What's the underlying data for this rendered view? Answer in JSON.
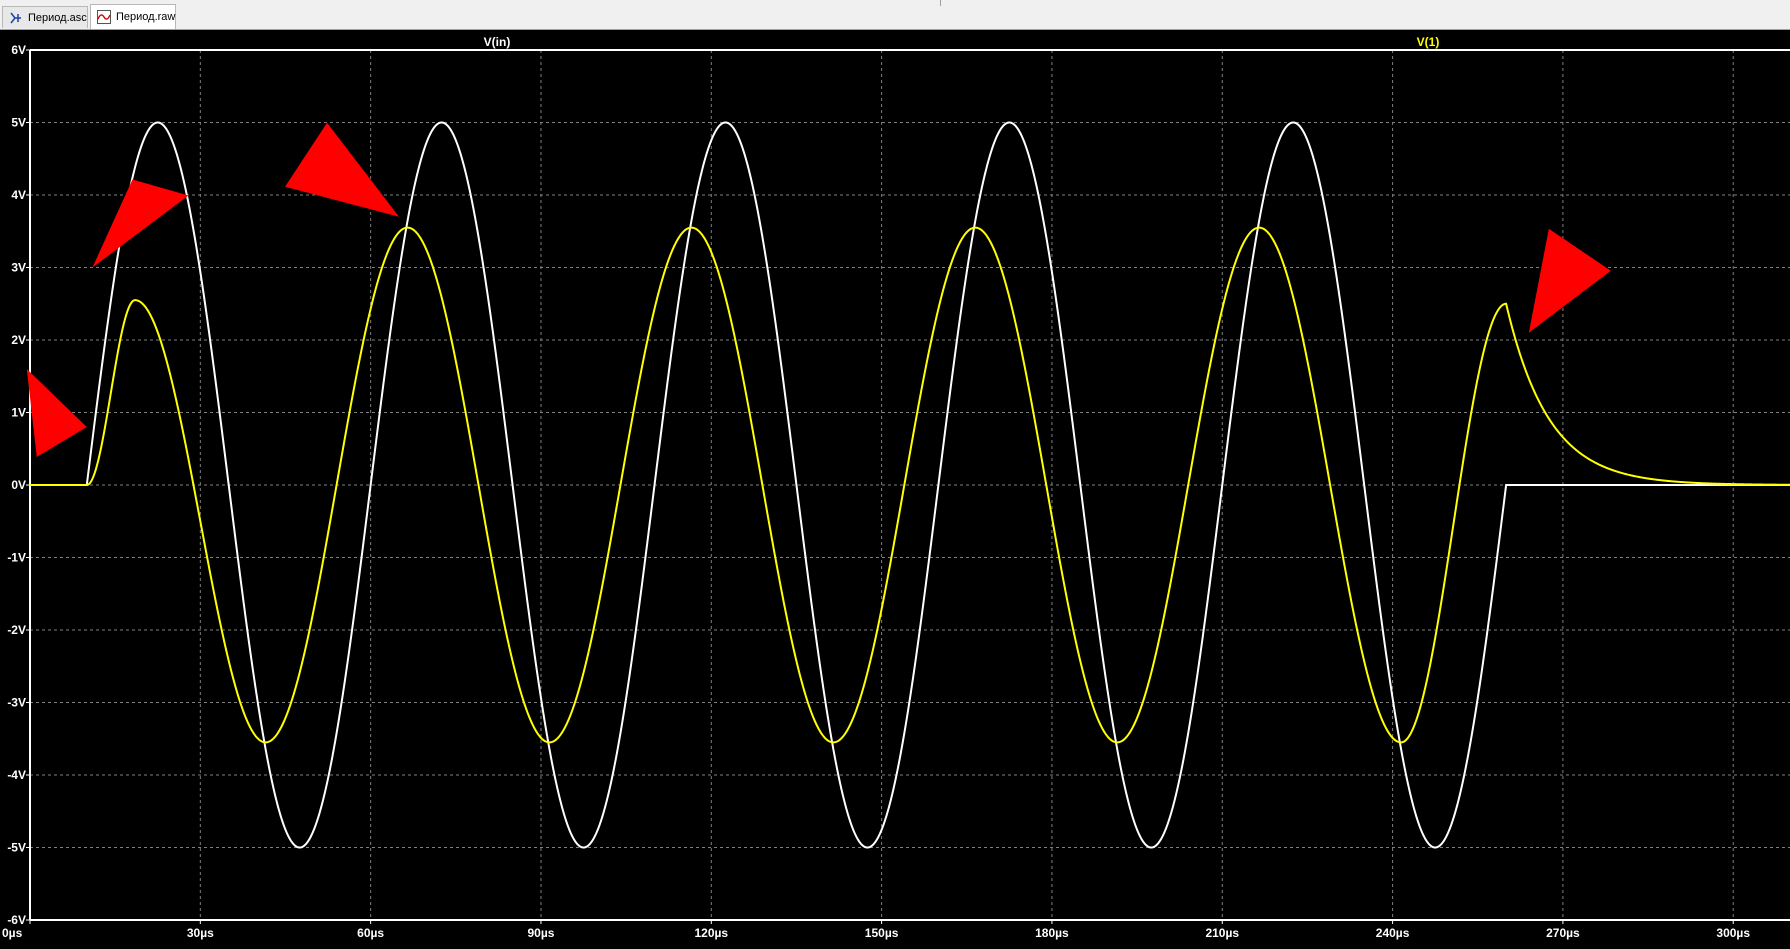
{
  "tabs": [
    {
      "label": "Период.asc",
      "icon": "schematic-icon"
    },
    {
      "label": "Период.raw",
      "icon": "waveform-icon"
    }
  ],
  "colors": {
    "background": "#000000",
    "grid": "#7f7f7f",
    "frame": "#ffffff",
    "series_in": "#ffffff",
    "series_out": "#ffff00",
    "annotation": "#ff0000"
  },
  "chart_data": {
    "type": "line",
    "title": "",
    "xlabel": "",
    "ylabel": "",
    "xlim": [
      0,
      310
    ],
    "ylim": [
      -6,
      6
    ],
    "grid": true,
    "x_unit": "µs",
    "y_unit": "V",
    "xticks": [
      "0µs",
      "30µs",
      "60µs",
      "90µs",
      "120µs",
      "150µs",
      "180µs",
      "210µs",
      "240µs",
      "270µs",
      "300µs"
    ],
    "xtick_values": [
      0,
      30,
      60,
      90,
      120,
      150,
      180,
      210,
      240,
      270,
      300
    ],
    "yticks": [
      "6V",
      "5V",
      "4V",
      "3V",
      "2V",
      "1V",
      "0V",
      "-1V",
      "-2V",
      "-3V",
      "-4V",
      "-5V",
      "-6V"
    ],
    "ytick_values": [
      6,
      5,
      4,
      3,
      2,
      1,
      0,
      -1,
      -2,
      -3,
      -4,
      -5,
      -6
    ],
    "series": [
      {
        "name": "V(in)",
        "color": "#ffffff",
        "description_points": {
          "x": [
            0,
            10,
            22.5,
            47.5,
            72.5,
            97.5,
            122.5,
            147.5,
            172.5,
            197.5,
            222.5,
            247.5,
            260,
            310
          ],
          "y": [
            0,
            0,
            5,
            -5,
            5,
            -5,
            5,
            -5,
            5,
            -5,
            5,
            -5,
            0,
            0
          ]
        },
        "waveform": {
          "shape": "sine",
          "start": 10,
          "stop": 260,
          "amplitude": 5,
          "period": 50,
          "offset": 0
        }
      },
      {
        "name": "V(1)",
        "color": "#ffff00",
        "description_points": {
          "x": [
            0,
            10,
            18.5,
            41.5,
            66.5,
            91.5,
            116.5,
            141.5,
            166.5,
            191.5,
            216.5,
            241.5,
            260,
            270,
            290,
            310
          ],
          "y": [
            0,
            0,
            2.55,
            -3.55,
            3.55,
            -3.55,
            3.55,
            -3.55,
            3.55,
            -3.55,
            3.55,
            -3.55,
            2.5,
            0.6,
            0.05,
            0
          ]
        }
      }
    ],
    "annotations": [
      {
        "type": "arrow",
        "color": "#ff0000",
        "points_to": {
          "x": 11,
          "y": 3.0
        }
      },
      {
        "type": "arrow",
        "color": "#ff0000",
        "points_to": {
          "x": 65,
          "y": 3.7
        }
      },
      {
        "type": "arrow",
        "color": "#ff0000",
        "points_to": {
          "x": 10,
          "y": 0.8
        }
      },
      {
        "type": "arrow",
        "color": "#ff0000",
        "points_to": {
          "x": 264,
          "y": 2.1
        }
      }
    ]
  }
}
